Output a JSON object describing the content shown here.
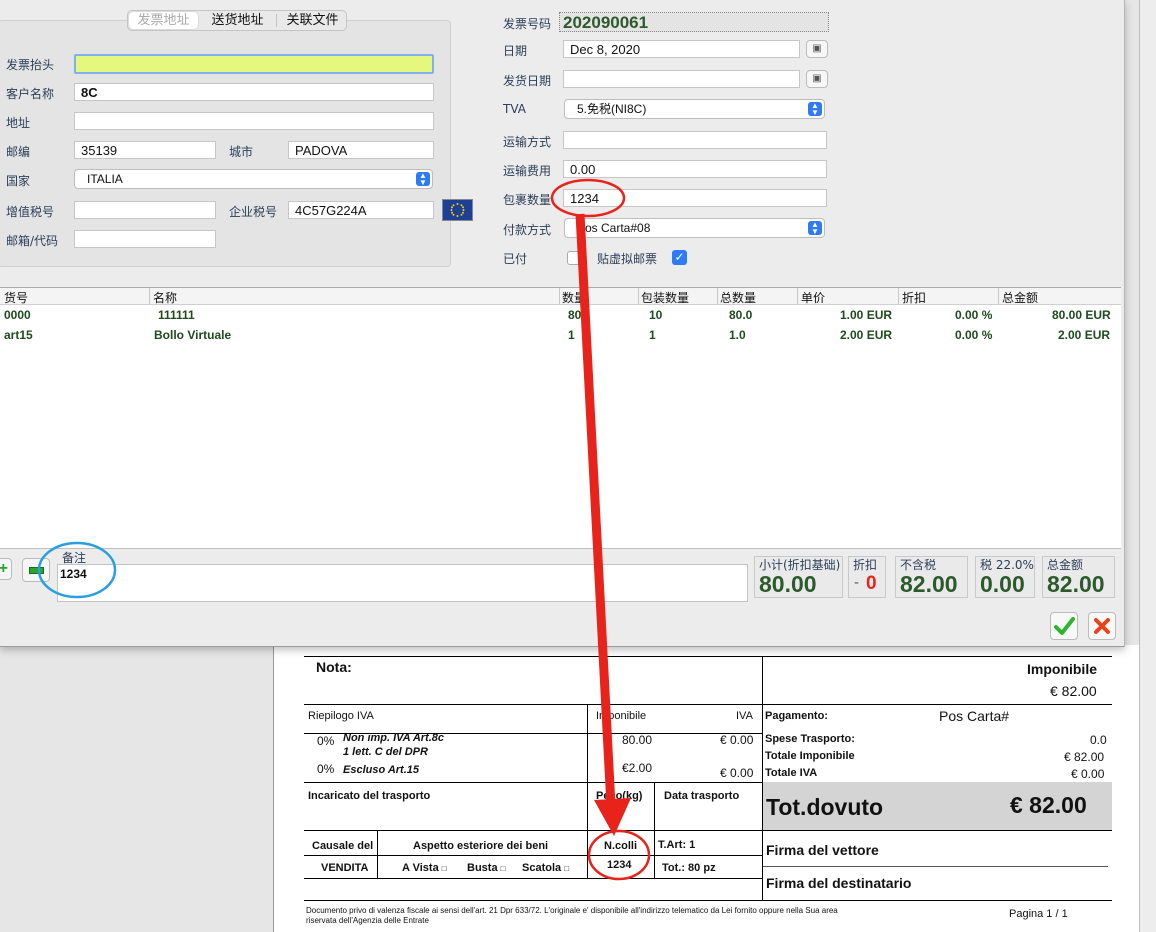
{
  "doc": {
    "nota_label": "Nota:",
    "imponibile_label": "Imponibile",
    "imponibile_value": "€ 82.00",
    "riepilogo_label": "Riepilogo IVA",
    "imponibile_col": "Imponibile",
    "iva_col": "IVA",
    "iva_rows": [
      {
        "pct": "0%",
        "desc1": "Non imp. IVA Art.8c",
        "desc2": "1 lett. C del DPR",
        "amount": "80.00",
        "iva": "€ 0.00"
      },
      {
        "pct": "0%",
        "desc1": "Escluso Art.15",
        "desc2": "",
        "amount": "€2.00",
        "iva": "€ 0.00"
      }
    ],
    "pagamento_label": "Pagamento:",
    "pagamento_value": "Pos Carta#",
    "spese_label": "Spese Trasporto:",
    "spese_value": "0.0",
    "totale_imp_label": "Totale Imponibile",
    "totale_imp_value": "€ 82.00",
    "totale_iva_label": "Totale IVA",
    "totale_iva_value": "€ 0.00",
    "incaricato_label": "Incaricato del trasporto",
    "peso_label": "Peso(kg)",
    "data_trasporto_label": "Data trasporto",
    "tot_dovuto_label": "Tot.dovuto",
    "tot_dovuto_value": "€ 82.00",
    "causale_label": "Causale del",
    "causale_value": "VENDITA",
    "aspetto_label": "Aspetto esteriore dei beni",
    "aspetto_a_vista": "A Vista",
    "aspetto_busta": "Busta",
    "aspetto_scatola": "Scatola",
    "ncolli_label": "N.colli",
    "ncolli_value": "1234",
    "tart_label": "T.Art: 1",
    "tot_pz": "Tot.: 80 pz",
    "firma_vettore": "Firma del vettore",
    "firma_destinatario": "Firma del destinatario",
    "footer_text_1": "Documento privo di valenza fiscale ai sensi dell'art. 21 Dpr 633/72. L'originale e' disponibile all'indirizzo telematico da Lei fornito oppure nella Sua area",
    "footer_text_2": "riservata dell'Agenzia delle Entrate",
    "page_label": "Pagina 1 / 1"
  },
  "tabs": [
    "发票地址",
    "送货地址",
    "关联文件"
  ],
  "left_form": {
    "invoice_header_label": "发票抬头",
    "invoice_header_value": "",
    "customer_name_label": "客户名称",
    "customer_name_value": "8C",
    "address_label": "地址",
    "address_value": "",
    "postcode_label": "邮编",
    "postcode_value": "35139",
    "city_label": "城市",
    "city_value": "PADOVA",
    "country_label": "国家",
    "country_value": "ITALIA",
    "vat_label": "增值税号",
    "vat_value": "",
    "company_tax_label": "企业税号",
    "company_tax_value": "4C57G224A",
    "email_label": "邮箱/代码",
    "email_value": ""
  },
  "right_form": {
    "invoice_no_label": "发票号码",
    "invoice_no_value": "202090061",
    "date_label": "日期",
    "date_value": "Dec 8, 2020",
    "ship_date_label": "发货日期",
    "ship_date_value": "",
    "tva_label": "TVA",
    "tva_value": "5.免税(NI8C)",
    "transport_label": "运输方式",
    "transport_value": "",
    "transport_cost_label": "运输费用",
    "transport_cost_value": "0.00",
    "packages_label": "包裹数量",
    "packages_value": "1234",
    "payment_label": "付款方式",
    "payment_value": "Pos Carta#08",
    "paid_label": "已付",
    "virtual_stamp_label": "贴虚拟邮票"
  },
  "table": {
    "headers": [
      "货号",
      "名称",
      "数量",
      "包装数量",
      "总数量",
      "单价",
      "折扣",
      "总金额"
    ],
    "rows": [
      {
        "code": "0000",
        "name": "111111",
        "qty": "80",
        "pack": "10",
        "total_qty": "80.0",
        "price": "1.00 EUR",
        "discount": "0.00 %",
        "amount": "80.00 EUR"
      },
      {
        "code": "art15",
        "name": "Bollo Virtuale",
        "qty": "1",
        "pack": "1",
        "total_qty": "1.0",
        "price": "2.00 EUR",
        "discount": "0.00 %",
        "amount": "2.00 EUR"
      }
    ]
  },
  "notes": {
    "label": "备注",
    "value": "1234"
  },
  "totals": {
    "subtotal_label": "小计(折扣基础)",
    "subtotal_value": "80.00",
    "discount_label": "折扣",
    "discount_value": "0",
    "net_label": "不含税",
    "net_value": "82.00",
    "tax_label": "税 22.0%",
    "tax_value": "0.00",
    "total_label": "总金额",
    "total_value": "82.00"
  },
  "colors": {
    "annotation_red": "#e8231b",
    "annotation_blue": "#2a9fe0",
    "accent_green": "#2d5a2d",
    "header_yellow": "#e5f77c"
  }
}
